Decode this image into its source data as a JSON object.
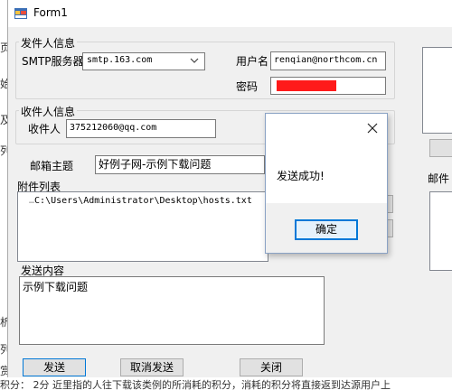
{
  "window": {
    "title": "Form1"
  },
  "sender_group": {
    "title": "发件人信息",
    "smtp_label": "SMTP服务器",
    "smtp_value": "smtp.163.com",
    "user_label": "用户名",
    "user_value": "renqian@northcom.cn",
    "password_label": "密码"
  },
  "recipient_group": {
    "title": "收件人信息",
    "recipient_label": "收件人",
    "recipient_value": "375212060@qq.com"
  },
  "subject": {
    "label": "邮箱主题",
    "value": "好例子网-示例下载问题"
  },
  "attachments": {
    "label": "附件列表",
    "items": [
      "C:\\Users\\Administrator\\Desktop\\hosts.txt"
    ]
  },
  "content": {
    "label": "发送内容",
    "value": "示例下载问题"
  },
  "buttons": {
    "send": "发送",
    "cancel_send": "取消发送",
    "close": "关闭"
  },
  "right_panel": {
    "label": "邮件"
  },
  "message_box": {
    "text": "发送成功!",
    "ok": "确定"
  },
  "background": {
    "left_chars": [
      "页",
      "始",
      "及",
      "列",
      "析",
      "列",
      "赏"
    ],
    "bottom_text": "积分：  2分    近里指的人往下载该类例的所消耗的积分，消耗的积分将直接返到达源用户上"
  },
  "colors": {
    "password_mask": "#ff1a1a",
    "ok_border": "#0078d7"
  }
}
